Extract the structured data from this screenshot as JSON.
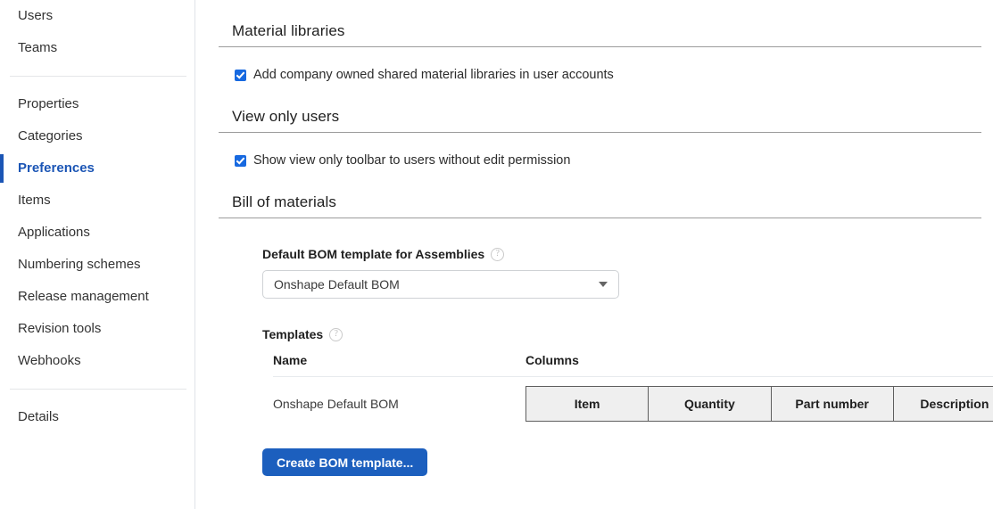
{
  "sidebar": {
    "groups": [
      {
        "items": [
          {
            "label": "Users",
            "active": false,
            "name": "sidebar-item-users"
          },
          {
            "label": "Teams",
            "active": false,
            "name": "sidebar-item-teams"
          }
        ]
      },
      {
        "items": [
          {
            "label": "Properties",
            "active": false,
            "name": "sidebar-item-properties"
          },
          {
            "label": "Categories",
            "active": false,
            "name": "sidebar-item-categories"
          },
          {
            "label": "Preferences",
            "active": true,
            "name": "sidebar-item-preferences"
          },
          {
            "label": "Items",
            "active": false,
            "name": "sidebar-item-items"
          },
          {
            "label": "Applications",
            "active": false,
            "name": "sidebar-item-applications"
          },
          {
            "label": "Numbering schemes",
            "active": false,
            "name": "sidebar-item-numbering-schemes"
          },
          {
            "label": "Release management",
            "active": false,
            "name": "sidebar-item-release-management"
          },
          {
            "label": "Revision tools",
            "active": false,
            "name": "sidebar-item-revision-tools"
          },
          {
            "label": "Webhooks",
            "active": false,
            "name": "sidebar-item-webhooks"
          }
        ]
      },
      {
        "items": [
          {
            "label": "Details",
            "active": false,
            "name": "sidebar-item-details"
          }
        ]
      }
    ],
    "active_color": "#1b55b5"
  },
  "main": {
    "material_libraries": {
      "title": "Material libraries",
      "checkbox_label": "Add company owned shared material libraries in user accounts",
      "checked": true
    },
    "view_only_users": {
      "title": "View only users",
      "checkbox_label": "Show view only toolbar to users without edit permission",
      "checked": true
    },
    "bill_of_materials": {
      "title": "Bill of materials",
      "default_template": {
        "label": "Default BOM template for Assemblies",
        "help": "?",
        "selected": "Onshape Default BOM",
        "options": [
          "Onshape Default BOM"
        ]
      },
      "templates": {
        "label": "Templates",
        "help": "?",
        "columns_headers": [
          "Name",
          "Columns"
        ],
        "rows": [
          {
            "name": "Onshape Default BOM",
            "columns": [
              "Item",
              "Quantity",
              "Part number",
              "Description"
            ]
          }
        ]
      },
      "create_button": "Create BOM template..."
    }
  },
  "colors": {
    "accent": "#1b55b5",
    "button": "#1c5fbe",
    "checkbox": "#1769e0",
    "rule": "#9b9b9b"
  }
}
